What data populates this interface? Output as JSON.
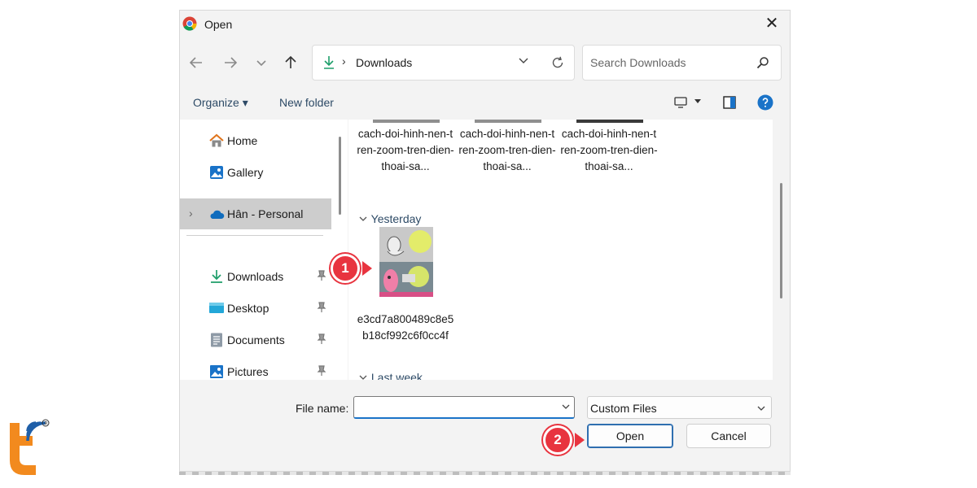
{
  "dialog": {
    "title": "Open",
    "close_symbol": "✕"
  },
  "navigation": {
    "back_icon": "arrow-left-icon",
    "forward_icon": "arrow-right-icon",
    "recent_icon": "chevron-down-icon",
    "up_icon": "arrow-up-icon",
    "address": {
      "separator": "›",
      "location": "Downloads"
    },
    "search": {
      "placeholder": "Search Downloads"
    }
  },
  "command_bar": {
    "organize_label": "Organize ▾",
    "new_folder_label": "New folder"
  },
  "sidebar": {
    "items": [
      {
        "label": "Home",
        "icon": "home-icon"
      },
      {
        "label": "Gallery",
        "icon": "gallery-icon"
      },
      {
        "label": "Hân - Personal",
        "icon": "onedrive-cloud-icon",
        "selected": true
      },
      {
        "label": "Downloads",
        "icon": "download-icon",
        "pinned": true
      },
      {
        "label": "Desktop",
        "icon": "desktop-icon",
        "pinned": true
      },
      {
        "label": "Documents",
        "icon": "documents-icon",
        "pinned": true
      },
      {
        "label": "Pictures",
        "icon": "pictures-icon",
        "pinned": true
      }
    ],
    "expand_chevron": "›"
  },
  "files": {
    "top_row": [
      "cach-doi-hinh-nen-tren-zoom-tren-dien-thoai-sa...",
      "cach-doi-hinh-nen-tren-zoom-tren-dien-thoai-sa...",
      "cach-doi-hinh-nen-tren-zoom-tren-dien-thoai-sa..."
    ],
    "groups": {
      "yesterday": "Yesterday",
      "last_week": "Last week"
    },
    "yesterday_file": "e3cd7a800489c8e5b18cf992c6f0cc4f"
  },
  "footer": {
    "file_name_label": "File name:",
    "file_name_value": "",
    "filter_value": "Custom Files",
    "open_label": "Open",
    "cancel_label": "Cancel"
  },
  "callouts": {
    "step1": "1",
    "step2": "2"
  },
  "colors": {
    "callout_red": "#e8343f",
    "accent_blue": "#1a73c8",
    "logo_orange": "#f28a1e",
    "logo_blue": "#1f5fa8"
  }
}
